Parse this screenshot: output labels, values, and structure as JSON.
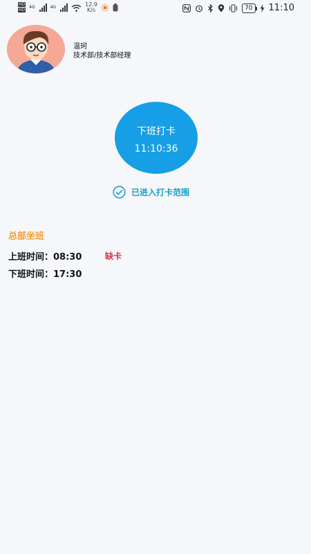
{
  "status_bar": {
    "network_speed_value": "12.9",
    "network_speed_unit": "K/s",
    "battery": "70",
    "time": "11:10"
  },
  "profile": {
    "name": "温珂",
    "department": "技术部/技术部经理"
  },
  "punch": {
    "label": "下班打卡",
    "time": "11:10:36",
    "range_status": "已进入打卡范围"
  },
  "schedule": {
    "title": "总部坐班",
    "clock_in_label": "上班时间：",
    "clock_in_time": "08:30",
    "clock_in_status": "缺卡",
    "clock_out_label": "下班时间：",
    "clock_out_time": "17:30"
  },
  "colors": {
    "accent": "#169ee6",
    "range_text": "#1a9fd0",
    "schedule_title": "#f5a031",
    "missing": "#d9304a",
    "background": "#f6f7fb"
  }
}
